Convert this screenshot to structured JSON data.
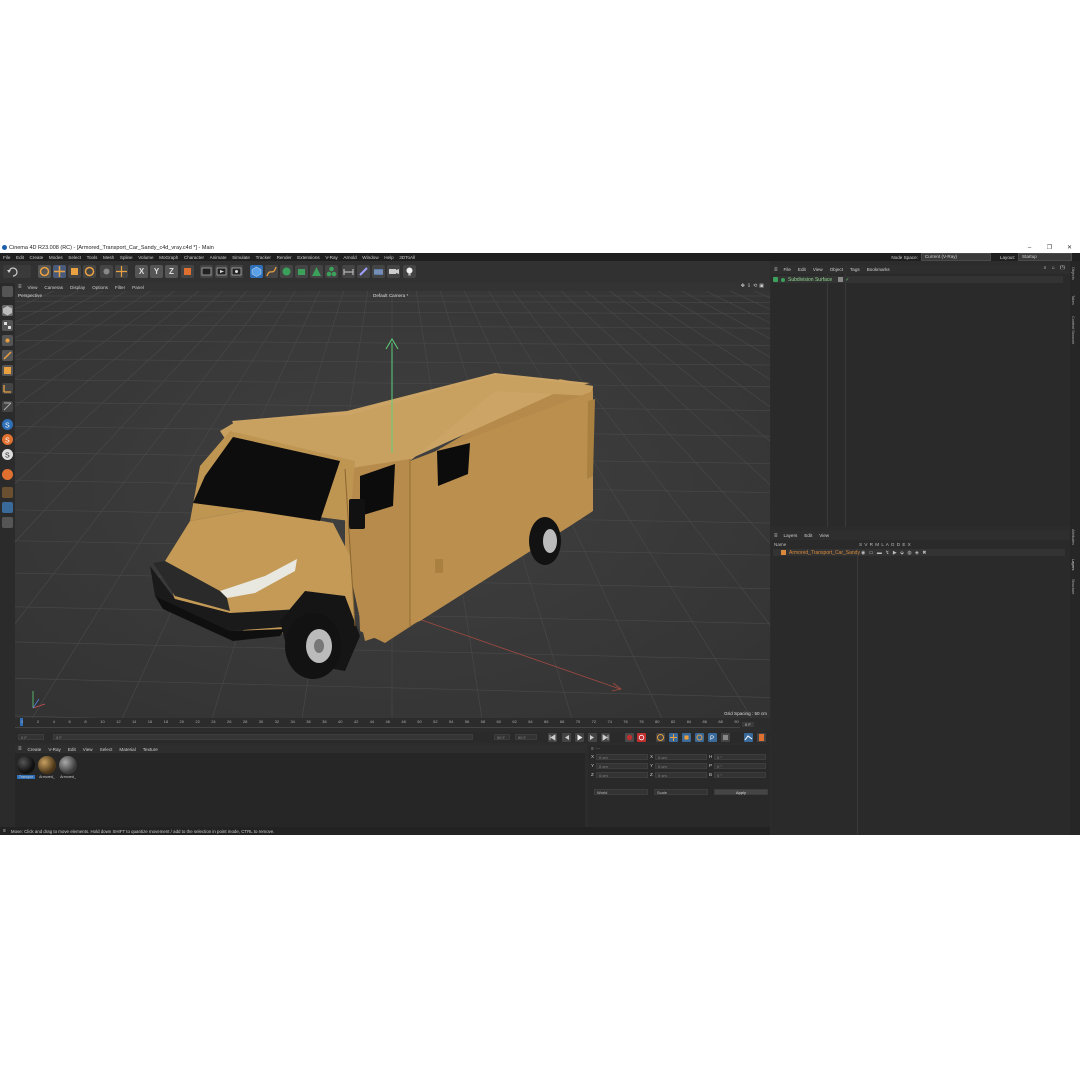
{
  "window": {
    "title": "Cinema 4D R23.008 (RC) - [Armored_Transport_Car_Sandy_c4d_vray.c4d *] - Main",
    "minimize": "–",
    "maximize": "❐",
    "close": "✕"
  },
  "menubar": {
    "items": [
      "File",
      "Edit",
      "Create",
      "Modes",
      "Select",
      "Tools",
      "Mesh",
      "Spline",
      "Volume",
      "MoGraph",
      "Character",
      "Animate",
      "Simulate",
      "Tracker",
      "Render",
      "Extensions",
      "V-Ray",
      "Arnold",
      "Window",
      "Help",
      "3DToAll"
    ],
    "node_space_label": "Node Space:",
    "node_space_value": "Current (V-Ray)",
    "layout_label": "Layout:",
    "layout_value": "Startup"
  },
  "viewport": {
    "menu": [
      "View",
      "Cameras",
      "Display",
      "Options",
      "Filter",
      "Panel"
    ],
    "view_name": "Perspective",
    "camera_name": "Default Camera *",
    "grid_spacing": "Grid Spacing : 50 cm"
  },
  "timeline": {
    "ticks": [
      "0",
      "2",
      "4",
      "6",
      "8",
      "10",
      "12",
      "14",
      "16",
      "18",
      "20",
      "22",
      "24",
      "26",
      "28",
      "30",
      "32",
      "34",
      "36",
      "38",
      "40",
      "42",
      "44",
      "46",
      "48",
      "50",
      "52",
      "54",
      "56",
      "58",
      "60",
      "62",
      "64",
      "66",
      "68",
      "70",
      "72",
      "74",
      "76",
      "78",
      "80",
      "82",
      "84",
      "86",
      "88",
      "90"
    ],
    "start_frame": "0 F",
    "current_field": "0 F",
    "end_field": "90 F",
    "end_field2": "90 F",
    "frame_right": "0 F"
  },
  "material_manager": {
    "menu": [
      "Create",
      "V-Ray",
      "Edit",
      "View",
      "Select",
      "Material",
      "Texture"
    ],
    "materials": [
      {
        "name": "Transpor",
        "color": "#111111"
      },
      {
        "name": "Armored_",
        "color": "#7a5a2a"
      },
      {
        "name": "Armored_",
        "color": "#555555"
      }
    ]
  },
  "coordinates": {
    "rows": [
      {
        "a": "X",
        "av": "0 cm",
        "b": "X",
        "bv": "0 cm",
        "c": "H",
        "cv": "0 °"
      },
      {
        "a": "Y",
        "av": "0 cm",
        "b": "Y",
        "bv": "0 cm",
        "c": "P",
        "cv": "0 °"
      },
      {
        "a": "Z",
        "av": "0 cm",
        "b": "Z",
        "bv": "0 cm",
        "c": "B",
        "cv": "0 °"
      }
    ],
    "mode1": "World",
    "mode2": "Scale",
    "apply": "Apply"
  },
  "object_manager": {
    "menu": [
      "File",
      "Edit",
      "View",
      "Object",
      "Tags",
      "Bookmarks"
    ],
    "items": [
      {
        "name": "Subdivision Surface"
      }
    ]
  },
  "layer_manager": {
    "menu": [
      "Layers",
      "Edit",
      "View"
    ],
    "header_name": "Name",
    "header_flags": "S V R M L A G D E X",
    "layers": [
      {
        "name": "Armored_Transport_Car_Sandy"
      }
    ]
  },
  "side_tabs": [
    "Objects",
    "Takes",
    "Content Browser",
    "Attributes",
    "Layers",
    "Structure"
  ],
  "status_text": "Move: Click and drag to move elements. Hold down SHIFT to quantize movement / add to the selection in point mode, CTRL to remove.",
  "colors": {
    "vehicle_body": "#c49a56",
    "vehicle_dark": "#101010",
    "grid_bg": "#3a3a3a",
    "accent_blue": "#2f6fb8",
    "layer_orange": "#d88a3a"
  }
}
